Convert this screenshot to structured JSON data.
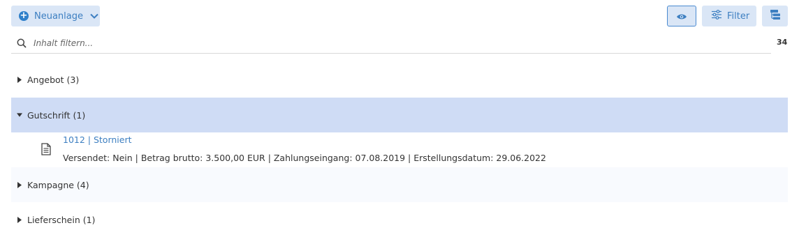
{
  "toolbar": {
    "new_label": "Neuanlage",
    "filter_label": "Filter"
  },
  "search": {
    "placeholder": "Inhalt filtern...",
    "value": ""
  },
  "result_count": "34",
  "groups": [
    {
      "label": "Angebot (3)",
      "expanded": false
    },
    {
      "label": "Gutschrift (1)",
      "expanded": true
    },
    {
      "label": "Kampagne (4)",
      "expanded": false
    },
    {
      "label": "Lieferschein (1)",
      "expanded": false
    }
  ],
  "gutschrift_entry": {
    "title": "1012 | Storniert",
    "details": "Versendet: Nein | Betrag brutto: 3.500,00 EUR | Zahlungseingang: 07.08.2019 | Erstellungsdatum: 29.06.2022"
  },
  "colors": {
    "accent": "#2f80ca",
    "button_bg": "#dae6f6",
    "selected_row": "#cfdcf5",
    "link": "#3d7fc1"
  }
}
